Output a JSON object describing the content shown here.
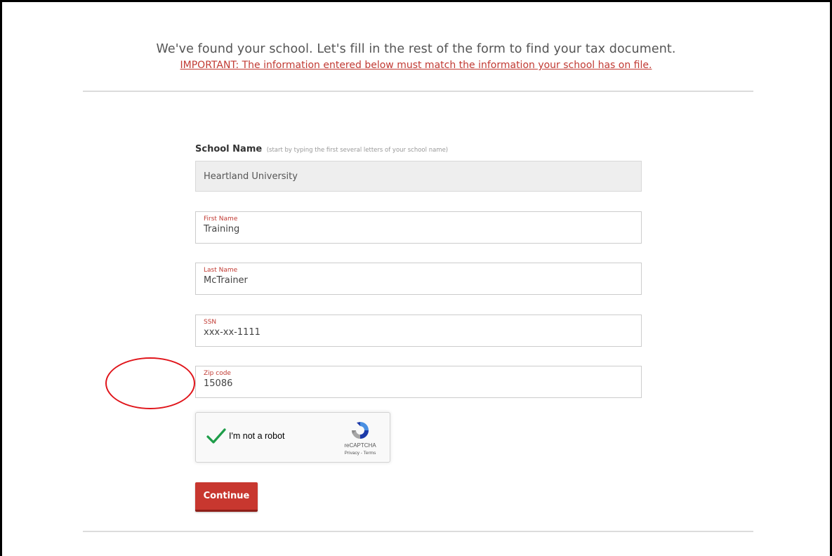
{
  "header": {
    "headline": "We've found your school. Let's fill in the rest of the form to find your tax document.",
    "important_note": "IMPORTANT: The information entered below must match the information your school has on file."
  },
  "form": {
    "school": {
      "label": "School Name",
      "hint": "(start by typing the first several letters of your school name)",
      "value": "Heartland University"
    },
    "first_name": {
      "label": "First Name",
      "value": "Training"
    },
    "last_name": {
      "label": "Last Name",
      "value": "McTrainer"
    },
    "ssn": {
      "label": "SSN",
      "value": "xxx-xx-1111"
    },
    "zip": {
      "label": "Zip code",
      "value": "15086"
    }
  },
  "recaptcha": {
    "label": "I'm not a robot",
    "brand": "reCAPTCHA",
    "links": "Privacy - Terms",
    "checked": true,
    "check_icon": "checkmark-icon",
    "logo_icon": "recaptcha-logo-icon"
  },
  "actions": {
    "continue_label": "Continue"
  },
  "colors": {
    "accent_red": "#c8372f",
    "label_red": "#c13a33",
    "annotation_red": "#e0141a",
    "check_green": "#1e9d49"
  }
}
